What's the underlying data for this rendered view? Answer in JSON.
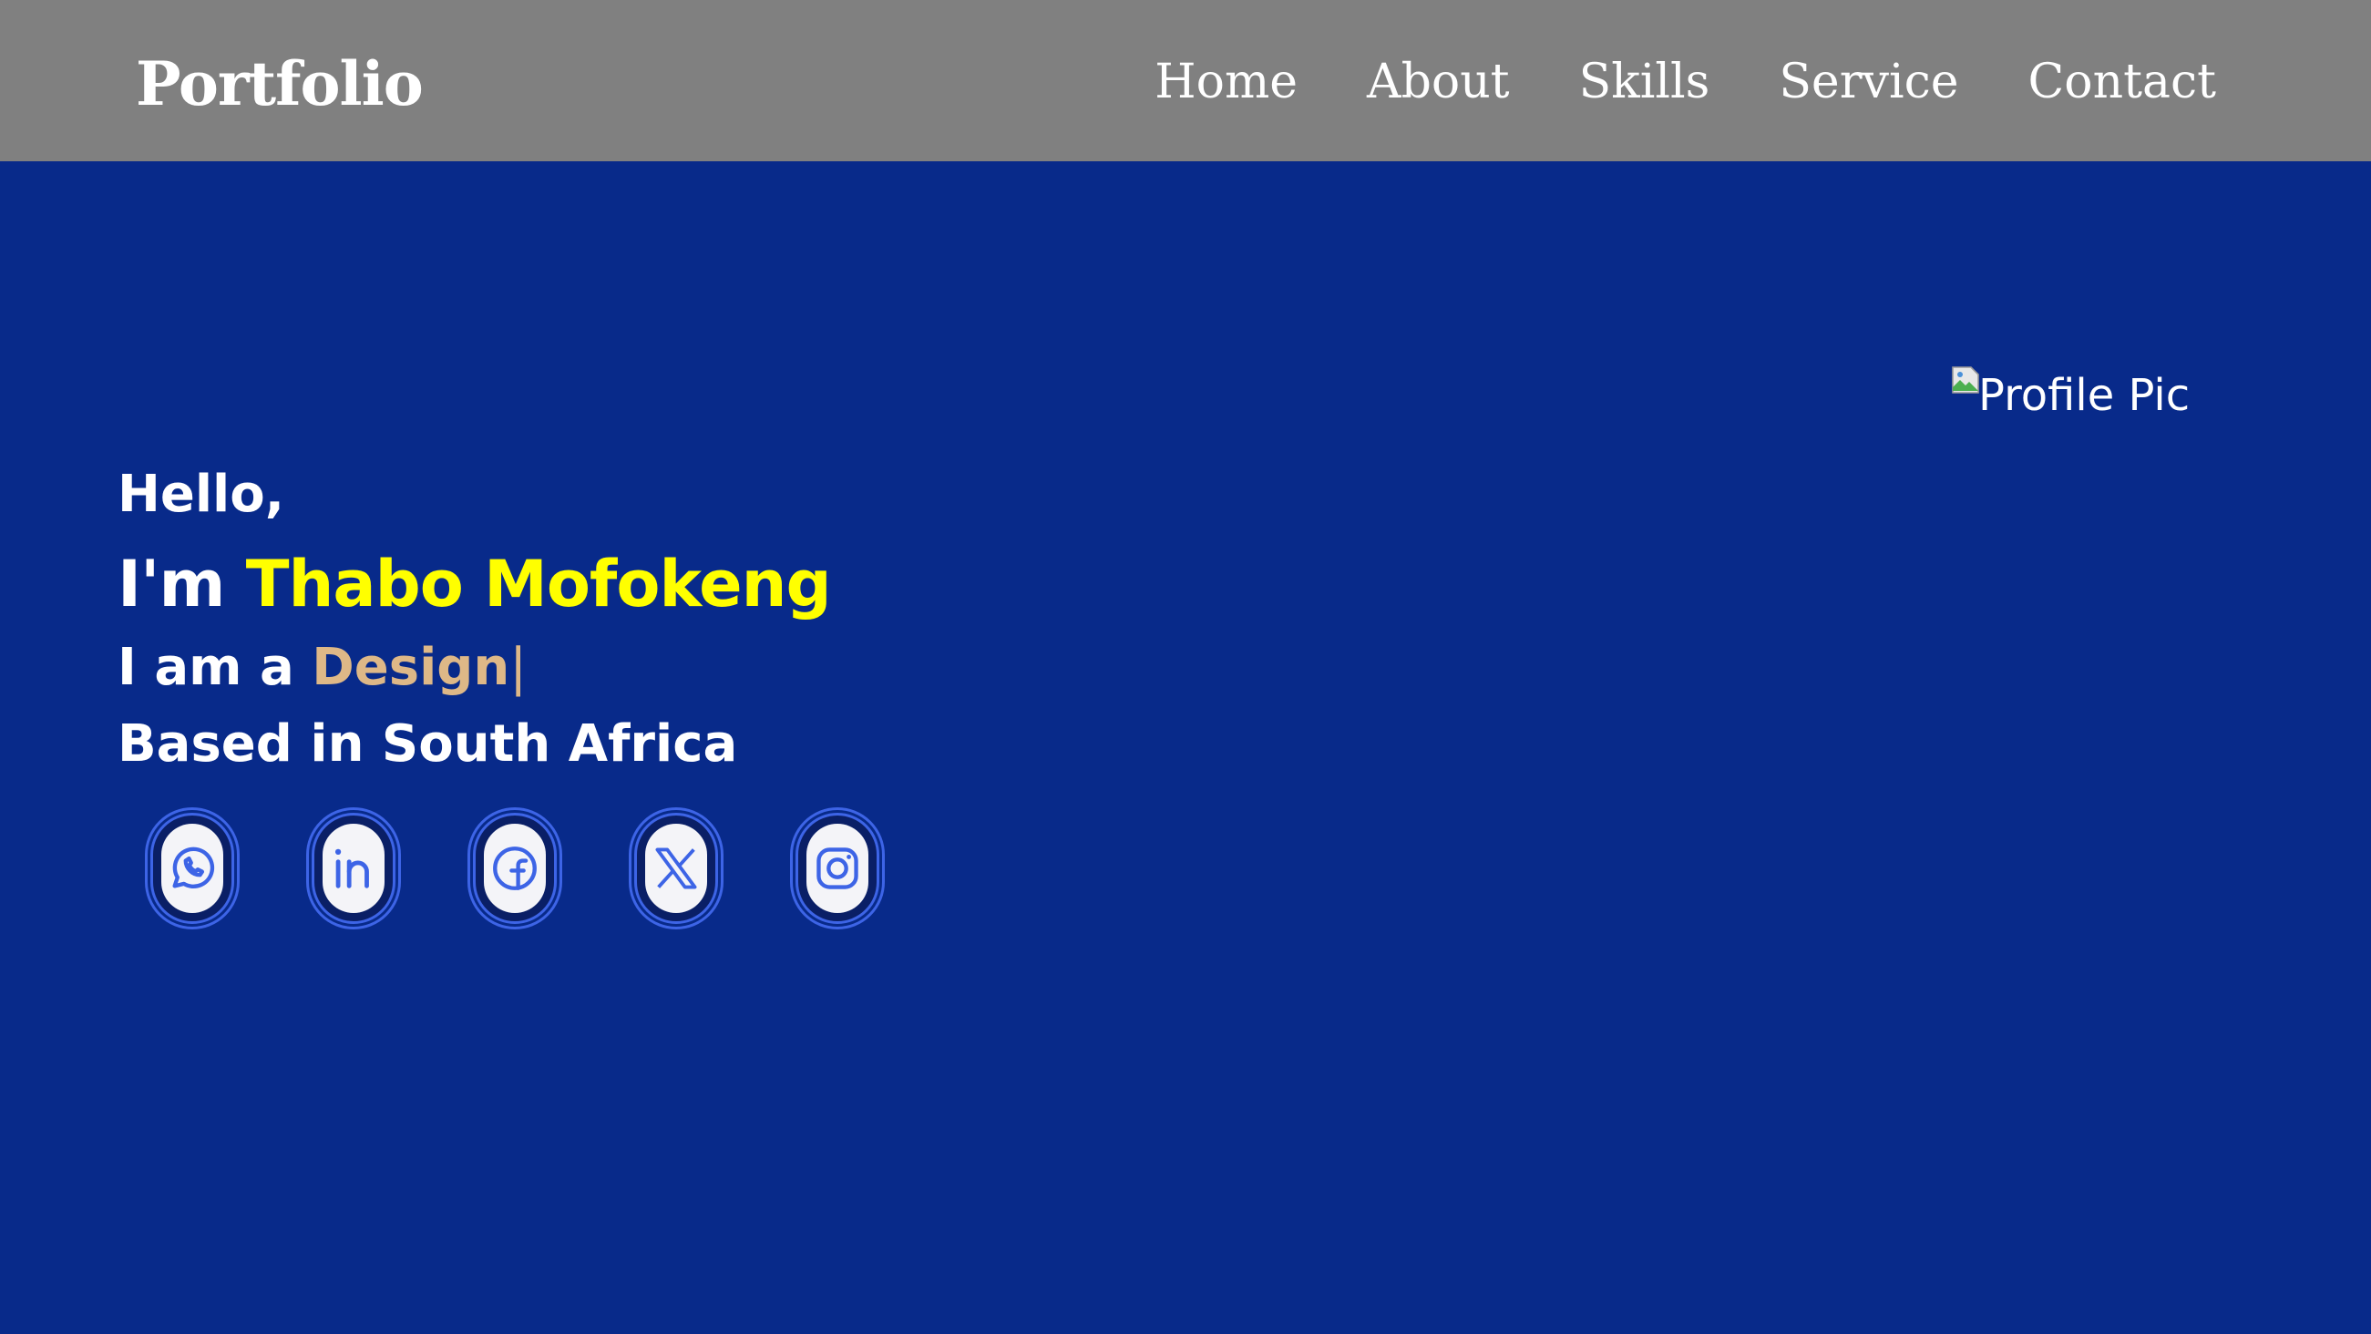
{
  "header": {
    "logo": "Portfolio",
    "nav": [
      "Home",
      "About",
      "Skills",
      "Service",
      "Contact"
    ]
  },
  "hero": {
    "greeting": "Hello,",
    "intro_prefix": "I'm ",
    "name": "Thabo Mofokeng",
    "role_prefix": "I am a ",
    "role": "Design",
    "cursor": "|",
    "location": "Based in South Africa"
  },
  "socials": [
    {
      "name": "whatsapp-icon"
    },
    {
      "name": "linkedin-icon"
    },
    {
      "name": "facebook-icon"
    },
    {
      "name": "x-twitter-icon"
    },
    {
      "name": "instagram-icon"
    }
  ],
  "profile": {
    "alt_text": "Profile Pic"
  },
  "colors": {
    "background": "#082a8a",
    "header": "#808080",
    "name": "#ffff00",
    "role": "#deb887",
    "icon_accent": "#3d64e6"
  }
}
